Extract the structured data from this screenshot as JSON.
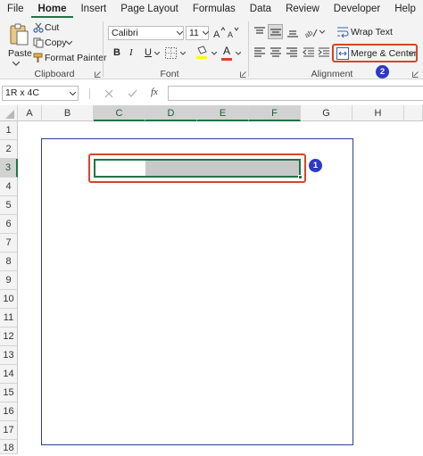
{
  "menu": {
    "tabs": [
      {
        "label": "File"
      },
      {
        "label": "Home"
      },
      {
        "label": "Insert"
      },
      {
        "label": "Page Layout"
      },
      {
        "label": "Formulas"
      },
      {
        "label": "Data"
      },
      {
        "label": "Review"
      },
      {
        "label": "Developer"
      },
      {
        "label": "Help"
      }
    ]
  },
  "ribbon": {
    "clipboard": {
      "paste_label": "Paste",
      "cut_label": "Cut",
      "copy_label": "Copy",
      "format_painter_label": "Format Painter",
      "group_label": "Clipboard"
    },
    "font": {
      "font_name": "Calibri",
      "font_size": "11",
      "group_label": "Font",
      "bold": "B",
      "italic": "I",
      "underline": "U",
      "font_color_glyph": "A"
    },
    "alignment": {
      "wrap_text_label": "Wrap Text",
      "merge_center_label": "Merge & Center",
      "group_label": "Alignment"
    }
  },
  "formula_bar": {
    "name_box": "1R x 4C",
    "fx": "fx",
    "value": ""
  },
  "grid": {
    "columns": [
      "A",
      "B",
      "C",
      "D",
      "E",
      "F",
      "G",
      "H"
    ],
    "rows": [
      "1",
      "2",
      "3",
      "4",
      "5",
      "6",
      "7",
      "8",
      "9",
      "10",
      "11",
      "12",
      "13",
      "14",
      "15",
      "16",
      "17",
      "18"
    ]
  },
  "annotations": {
    "badge1": "1",
    "badge2": "2"
  },
  "colors": {
    "accent_green": "#217346",
    "highlight_red": "#d6452b",
    "badge_blue": "#2f39c6",
    "selection_gray": "#c8c8c8"
  }
}
